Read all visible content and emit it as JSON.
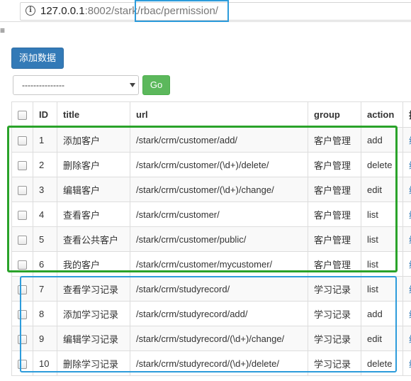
{
  "browser": {
    "url_host": "127.0.0.1",
    "url_rest": ":8002/stark/rbac/permission/"
  },
  "page": {
    "left_glyph": "≡"
  },
  "toolbar": {
    "add_label": "添加数据",
    "select_value": "---------------",
    "go_label": "Go"
  },
  "table": {
    "headers": [
      "ID",
      "title",
      "url",
      "group",
      "action",
      "操"
    ],
    "rows": [
      {
        "id": "1",
        "title": "添加客户",
        "url": "/stark/crm/customer/add/",
        "group": "客户管理",
        "action": "add",
        "extra": "编"
      },
      {
        "id": "2",
        "title": "删除客户",
        "url": "/stark/crm/customer/(\\d+)/delete/",
        "group": "客户管理",
        "action": "delete",
        "extra": "编"
      },
      {
        "id": "3",
        "title": "编辑客户",
        "url": "/stark/crm/customer/(\\d+)/change/",
        "group": "客户管理",
        "action": "edit",
        "extra": "编"
      },
      {
        "id": "4",
        "title": "查看客户",
        "url": "/stark/crm/customer/",
        "group": "客户管理",
        "action": "list",
        "extra": "编"
      },
      {
        "id": "5",
        "title": "查看公共客户",
        "url": "/stark/crm/customer/public/",
        "group": "客户管理",
        "action": "list",
        "extra": "编"
      },
      {
        "id": "6",
        "title": "我的客户",
        "url": "/stark/crm/customer/mycustomer/",
        "group": "客户管理",
        "action": "list",
        "extra": "编"
      },
      {
        "id": "7",
        "title": "查看学习记录",
        "url": "/stark/crm/studyrecord/",
        "group": "学习记录",
        "action": "list",
        "extra": "编"
      },
      {
        "id": "8",
        "title": "添加学习记录",
        "url": "/stark/crm/studyrecord/add/",
        "group": "学习记录",
        "action": "add",
        "extra": "编"
      },
      {
        "id": "9",
        "title": "编辑学习记录",
        "url": "/stark/crm/studyrecord/(\\d+)/change/",
        "group": "学习记录",
        "action": "edit",
        "extra": "编"
      },
      {
        "id": "10",
        "title": "删除学习记录",
        "url": "/stark/crm/studyrecord/(\\d+)/delete/",
        "group": "学习记录",
        "action": "delete",
        "extra": "编"
      }
    ]
  },
  "colors": {
    "primary": "#337ab7",
    "success": "#5cb85c",
    "highlight_green": "#2aa32a",
    "highlight_blue": "#2d9cdb"
  }
}
